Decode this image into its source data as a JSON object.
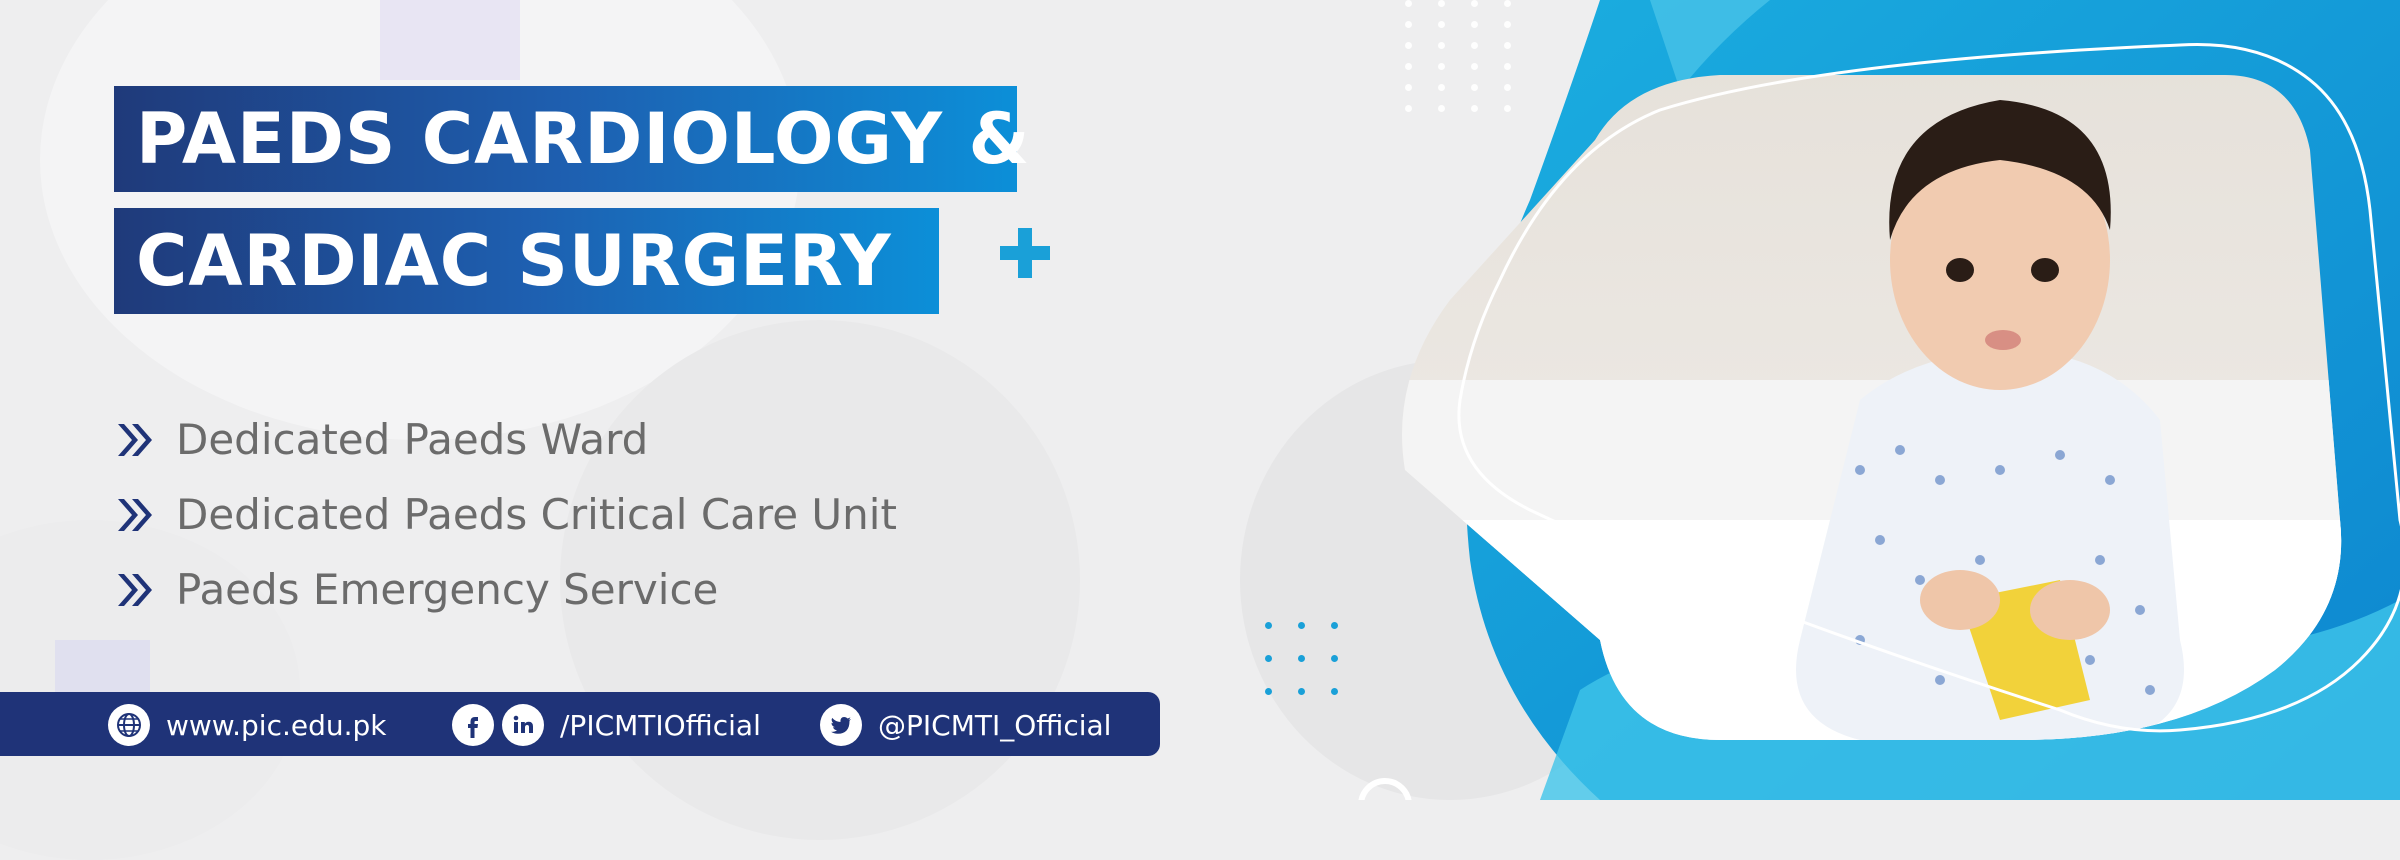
{
  "banner": {
    "title_line1": "PAEDS CARDIOLOGY &",
    "title_line2": "CARDIAC SURGERY",
    "features": [
      "Dedicated Paeds Ward",
      "Dedicated Paeds Critical Care Unit",
      "Paeds Emergency Service"
    ],
    "footer": {
      "website": "www.pic.edu.pk",
      "social_handle": "/PICMTIOfficial",
      "twitter_handle": "@PICMTI_Official"
    },
    "colors": {
      "navy": "#1f3378",
      "accent_blue": "#1aa0d8",
      "background": "#eeeeef"
    },
    "icons": [
      "plus-icon",
      "chevron-double-right-icon",
      "globe-icon",
      "facebook-icon",
      "linkedin-icon",
      "twitter-icon"
    ]
  }
}
